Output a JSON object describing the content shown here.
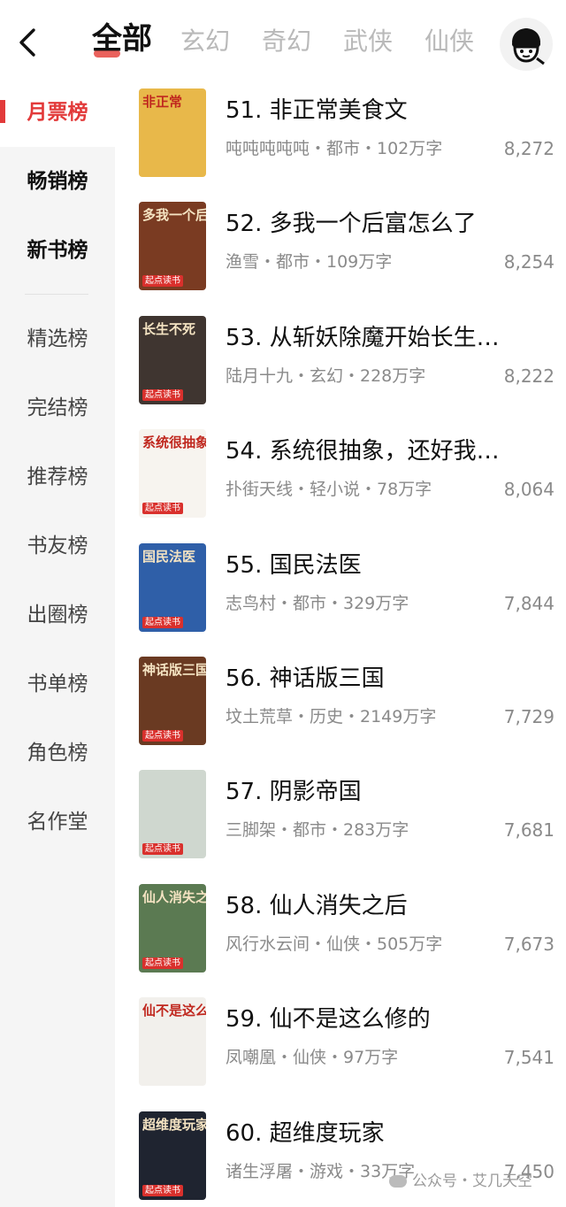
{
  "header": {
    "tabs": [
      "全部",
      "玄幻",
      "奇幻",
      "武侠",
      "仙侠"
    ]
  },
  "sidebar": {
    "items": [
      "月票榜",
      "畅销榜",
      "新书榜",
      "精选榜",
      "完结榜",
      "推荐榜",
      "书友榜",
      "出圈榜",
      "书单榜",
      "角色榜",
      "名作堂"
    ],
    "active_index": 0
  },
  "books": [
    {
      "title": "51. 非正常美食文",
      "meta": "吨吨吨吨吨・都市・102万字",
      "count": "8,272",
      "cover_text": "非正常",
      "cover_color": "#e8b84a",
      "cover_tag": ""
    },
    {
      "title": "52. 多我一个后富怎么了",
      "meta": "渔雪・都市・109万字",
      "count": "8,254",
      "cover_text": "多我一个后富怎么了",
      "cover_color": "#7a3b22",
      "cover_tag": "起点读书"
    },
    {
      "title": "53. 从斩妖除魔开始长生…",
      "meta": "陆月十九・玄幻・228万字",
      "count": "8,222",
      "cover_text": "长生不死",
      "cover_color": "#3f3530",
      "cover_tag": "起点读书"
    },
    {
      "title": "54. 系统很抽象，还好我…",
      "meta": "扑街天线・轻小说・78万字",
      "count": "8,064",
      "cover_text": "系统很抽象",
      "cover_color": "#f7f4ef",
      "cover_tag": "起点读书"
    },
    {
      "title": "55. 国民法医",
      "meta": "志鸟村・都市・329万字",
      "count": "7,844",
      "cover_text": "国民法医",
      "cover_color": "#2f5fa8",
      "cover_tag": "起点读书"
    },
    {
      "title": "56. 神话版三国",
      "meta": "坟土荒草・历史・2149万字",
      "count": "7,729",
      "cover_text": "神话版三国",
      "cover_color": "#6a3a22",
      "cover_tag": "起点读书"
    },
    {
      "title": "57. 阴影帝国",
      "meta": "三脚架・都市・283万字",
      "count": "7,681",
      "cover_text": "",
      "cover_color": "#cfd7cf",
      "cover_tag": "起点读书"
    },
    {
      "title": "58. 仙人消失之后",
      "meta": "风行水云间・仙侠・505万字",
      "count": "7,673",
      "cover_text": "仙人消失之后",
      "cover_color": "#5b7a52",
      "cover_tag": "起点读书"
    },
    {
      "title": "59. 仙不是这么修的",
      "meta": "凤嘲凰・仙侠・97万字",
      "count": "7,541",
      "cover_text": "仙不是这么修的",
      "cover_color": "#f2f0ec",
      "cover_tag": ""
    },
    {
      "title": "60. 超维度玩家",
      "meta": "诸生浮屠・游戏・33万字",
      "count": "7,450",
      "cover_text": "超维度玩家",
      "cover_color": "#1f2430",
      "cover_tag": "起点读书"
    }
  ],
  "watermark": "公众号・艾几天空"
}
